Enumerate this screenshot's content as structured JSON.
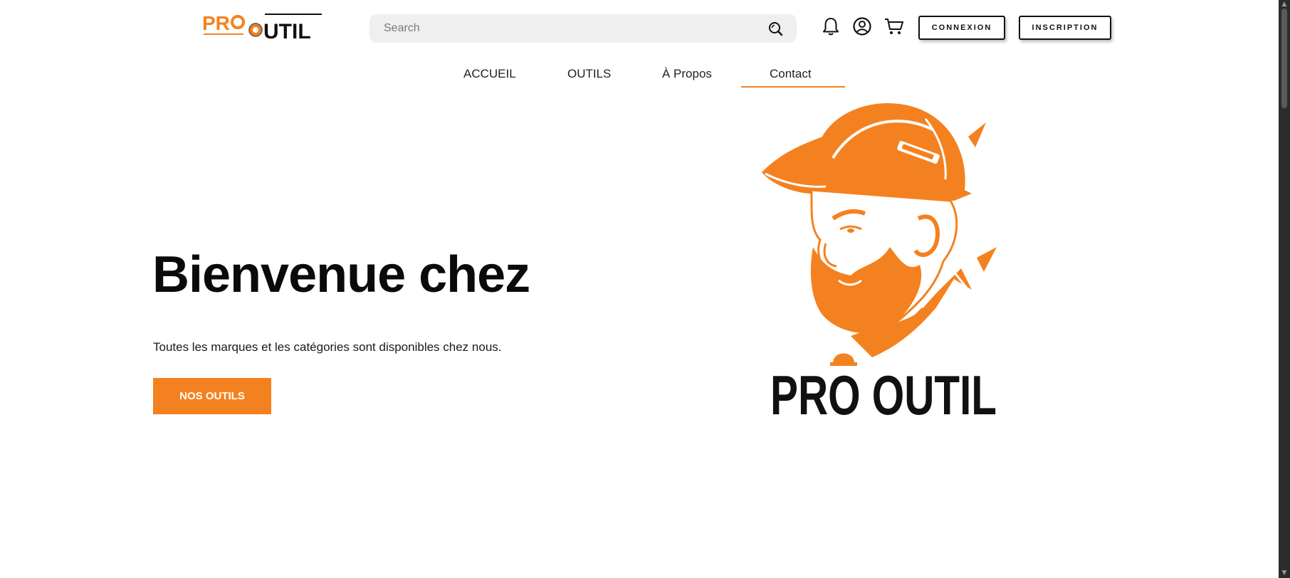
{
  "header": {
    "logo": {
      "word1": "PRO",
      "word2": "UTIL",
      "accent_color": "#f4811f"
    },
    "search": {
      "placeholder": "Search",
      "value": "",
      "icon": "search-icon"
    },
    "icons": [
      "bell-icon",
      "user-icon",
      "cart-icon"
    ],
    "login_label": "CONNEXION",
    "signup_label": "INSCRIPTION"
  },
  "nav": {
    "items": [
      {
        "label": "ACCUEIL",
        "active": false
      },
      {
        "label": "OUTILS",
        "active": false
      },
      {
        "label": "À Propos",
        "active": false
      },
      {
        "label": "Contact",
        "active": true
      }
    ],
    "active_color": "#f48120"
  },
  "hero": {
    "title": "Bienvenue chez",
    "subtitle": "Toutes les marques et les catégories sont disponibles chez nous.",
    "cta_label": "NOS OUTILS",
    "cta_color": "#f4811f",
    "brand_wordmark": "PRO OUTIL",
    "illustration": "construction-worker-hardhat-illustration"
  },
  "scrollbar": {
    "up": "▲",
    "down": "▼"
  }
}
